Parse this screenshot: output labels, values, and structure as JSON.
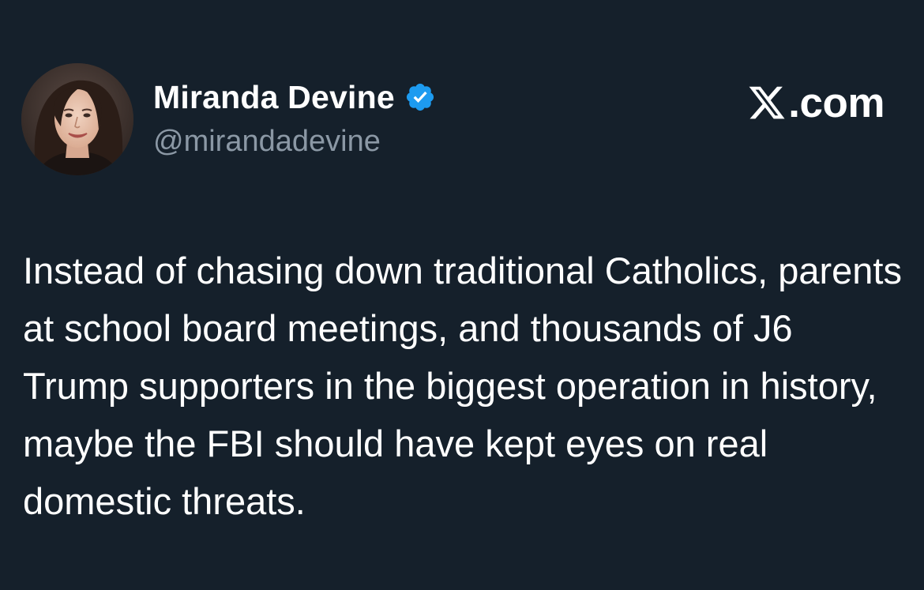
{
  "author": {
    "display_name": "Miranda Devine",
    "handle": "@mirandadevine",
    "verified": true,
    "avatar_icon": "profile-photo"
  },
  "brand": {
    "logo_icon": "x-logo-icon",
    "suffix": ".com"
  },
  "tweet": {
    "text": "Instead of chasing down traditional Catholics, parents at school board meetings, and thousands of J6 Trump supporters in the biggest operation in history, maybe the FBI should have kept eyes on real domestic threats."
  },
  "colors": {
    "background": "#15202b",
    "text_primary": "#ffffff",
    "text_secondary": "#8b98a5",
    "verified_badge": "#1d9bf0"
  }
}
